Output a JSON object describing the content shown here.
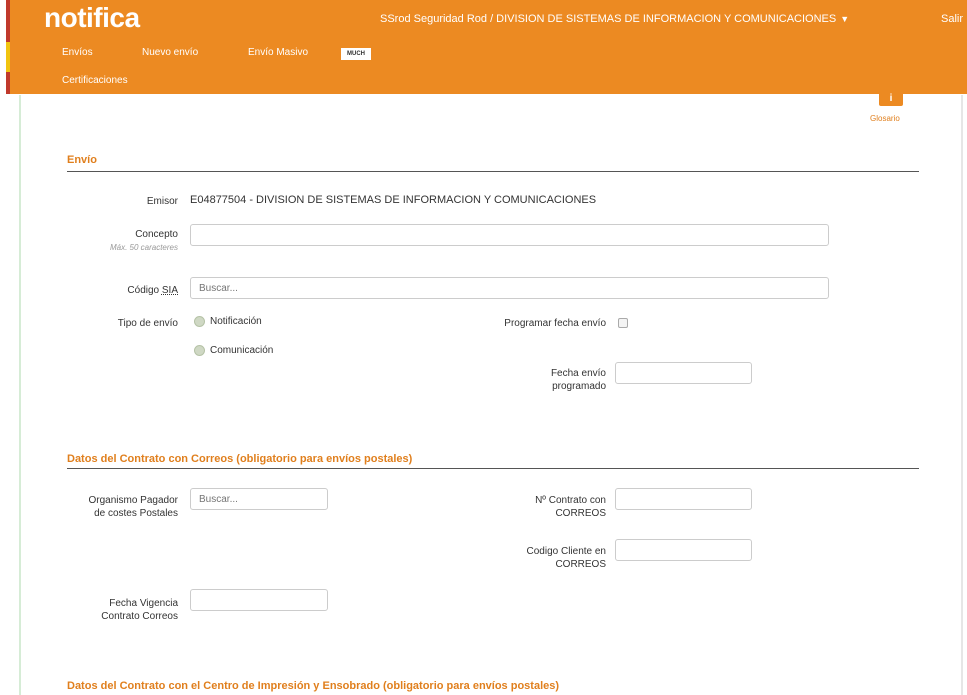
{
  "app": {
    "logo": "notifica",
    "user_menu": "SSrod Seguridad Rod / DIVISION DE SISTEMAS DE INFORMACION Y COMUNICACIONES",
    "logout": "Salir",
    "overlap_text": "MUCH"
  },
  "nav": {
    "items": [
      "Envíos",
      "Nuevo envío",
      "Envío Masivo",
      "Certificaciones"
    ]
  },
  "glosario": {
    "icon": "i",
    "label": "Glosario"
  },
  "envio": {
    "title": "Envío",
    "emisor_label": "Emisor",
    "emisor_value": "E04877504 - DIVISION DE SISTEMAS DE INFORMACION Y COMUNICACIONES",
    "concepto_label": "Concepto",
    "concepto_hint": "Máx. 50 caracteres",
    "concepto_value": "",
    "sia_label_prefix": "Código ",
    "sia_label_abbr": "SIA",
    "sia_placeholder": "Buscar...",
    "tipo_label": "Tipo de envío",
    "tipo_options": [
      "Notificación",
      "Comunicación"
    ],
    "programar_label": "Programar fecha envío",
    "fecha_programado_label": "Fecha envío programado"
  },
  "correos": {
    "title": "Datos del Contrato con Correos (obligatorio para envíos postales)",
    "organismo_label": "Organismo Pagador de costes Postales",
    "organismo_placeholder": "Buscar...",
    "contrato_label": "Nº Contrato con CORREOS",
    "cliente_label": "Codigo Cliente en CORREOS",
    "vigencia_label": "Fecha Vigencia Contrato Correos"
  },
  "impresion": {
    "title": "Datos del Contrato con el Centro de Impresión y Ensobrado (obligatorio para envíos postales)"
  },
  "colors": {
    "accent": "#ec8a22",
    "section_title": "#e07f1d"
  }
}
